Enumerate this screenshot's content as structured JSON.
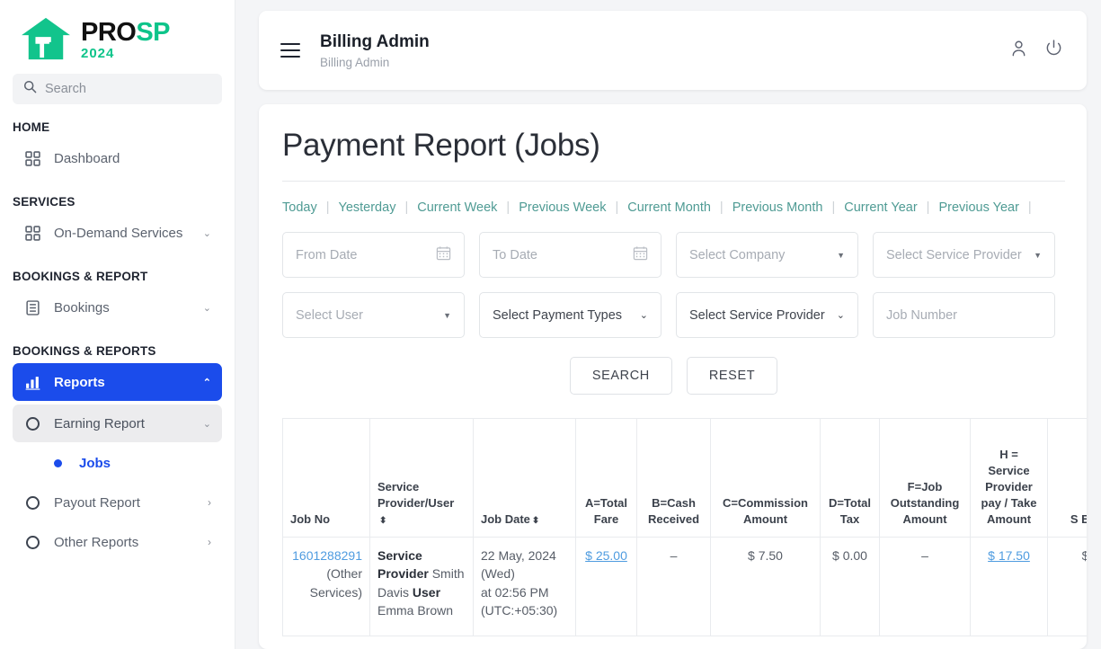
{
  "brand": {
    "pro": "PRO",
    "sp": "SP",
    "year": "2024"
  },
  "sidebar": {
    "search_placeholder": "Search",
    "sections": {
      "home": "HOME",
      "services": "SERVICES",
      "bookings_report": "BOOKINGS & REPORT",
      "bookings_reports": "BOOKINGS & REPORTS"
    },
    "items": {
      "dashboard": "Dashboard",
      "on_demand_services": "On-Demand Services",
      "bookings": "Bookings",
      "reports": "Reports",
      "earning_report": "Earning Report",
      "jobs": "Jobs",
      "payout_report": "Payout Report",
      "other_reports": "Other Reports"
    }
  },
  "topbar": {
    "title": "Billing Admin",
    "subtitle": "Billing Admin"
  },
  "page": {
    "title": "Payment Report (Jobs)"
  },
  "quick_filters": [
    "Today",
    "Yesterday",
    "Current Week",
    "Previous Week",
    "Current Month",
    "Previous Month",
    "Current Year",
    "Previous Year"
  ],
  "filters": {
    "from_date": "From Date",
    "to_date": "To Date",
    "select_company": "Select Company",
    "select_service_provider": "Select Service Provider",
    "select_user": "Select User",
    "select_payment_types": "Select Payment Types",
    "select_service_provider_2": "Select Service Provider",
    "job_number": "Job Number"
  },
  "buttons": {
    "search": "SEARCH",
    "reset": "RESET"
  },
  "table": {
    "headers": [
      "Job No",
      "Service Provider/User",
      "Job Date",
      "A=Total Fare",
      "B=Cash Received",
      "C=Commission Amount",
      "D=Total Tax",
      "F=Job Outstanding Amount",
      "H = Service Provider pay / Take Amount",
      "S Ear"
    ],
    "rows": [
      {
        "job_no": "1601288291",
        "job_type": "(Other Services)",
        "provider_label": "Service Provider",
        "provider_name": "Smith Davis",
        "user_label": "User",
        "user_name": "Emma Brown",
        "job_date": "22 May, 2024 (Wed)",
        "job_time": "at 02:56 PM (UTC:+05:30)",
        "total_fare": "$ 25.00",
        "cash_received": "–",
        "commission_amount": "$ 7.50",
        "total_tax": "$ 0.00",
        "outstanding_amount": "–",
        "provider_take": "$ 17.50",
        "site_earning": "$"
      }
    ]
  },
  "colors": {
    "accent": "#1b4ceb",
    "brand_green": "#0ec48a",
    "teal": "#4f9b94",
    "link": "#4f9ce0"
  }
}
